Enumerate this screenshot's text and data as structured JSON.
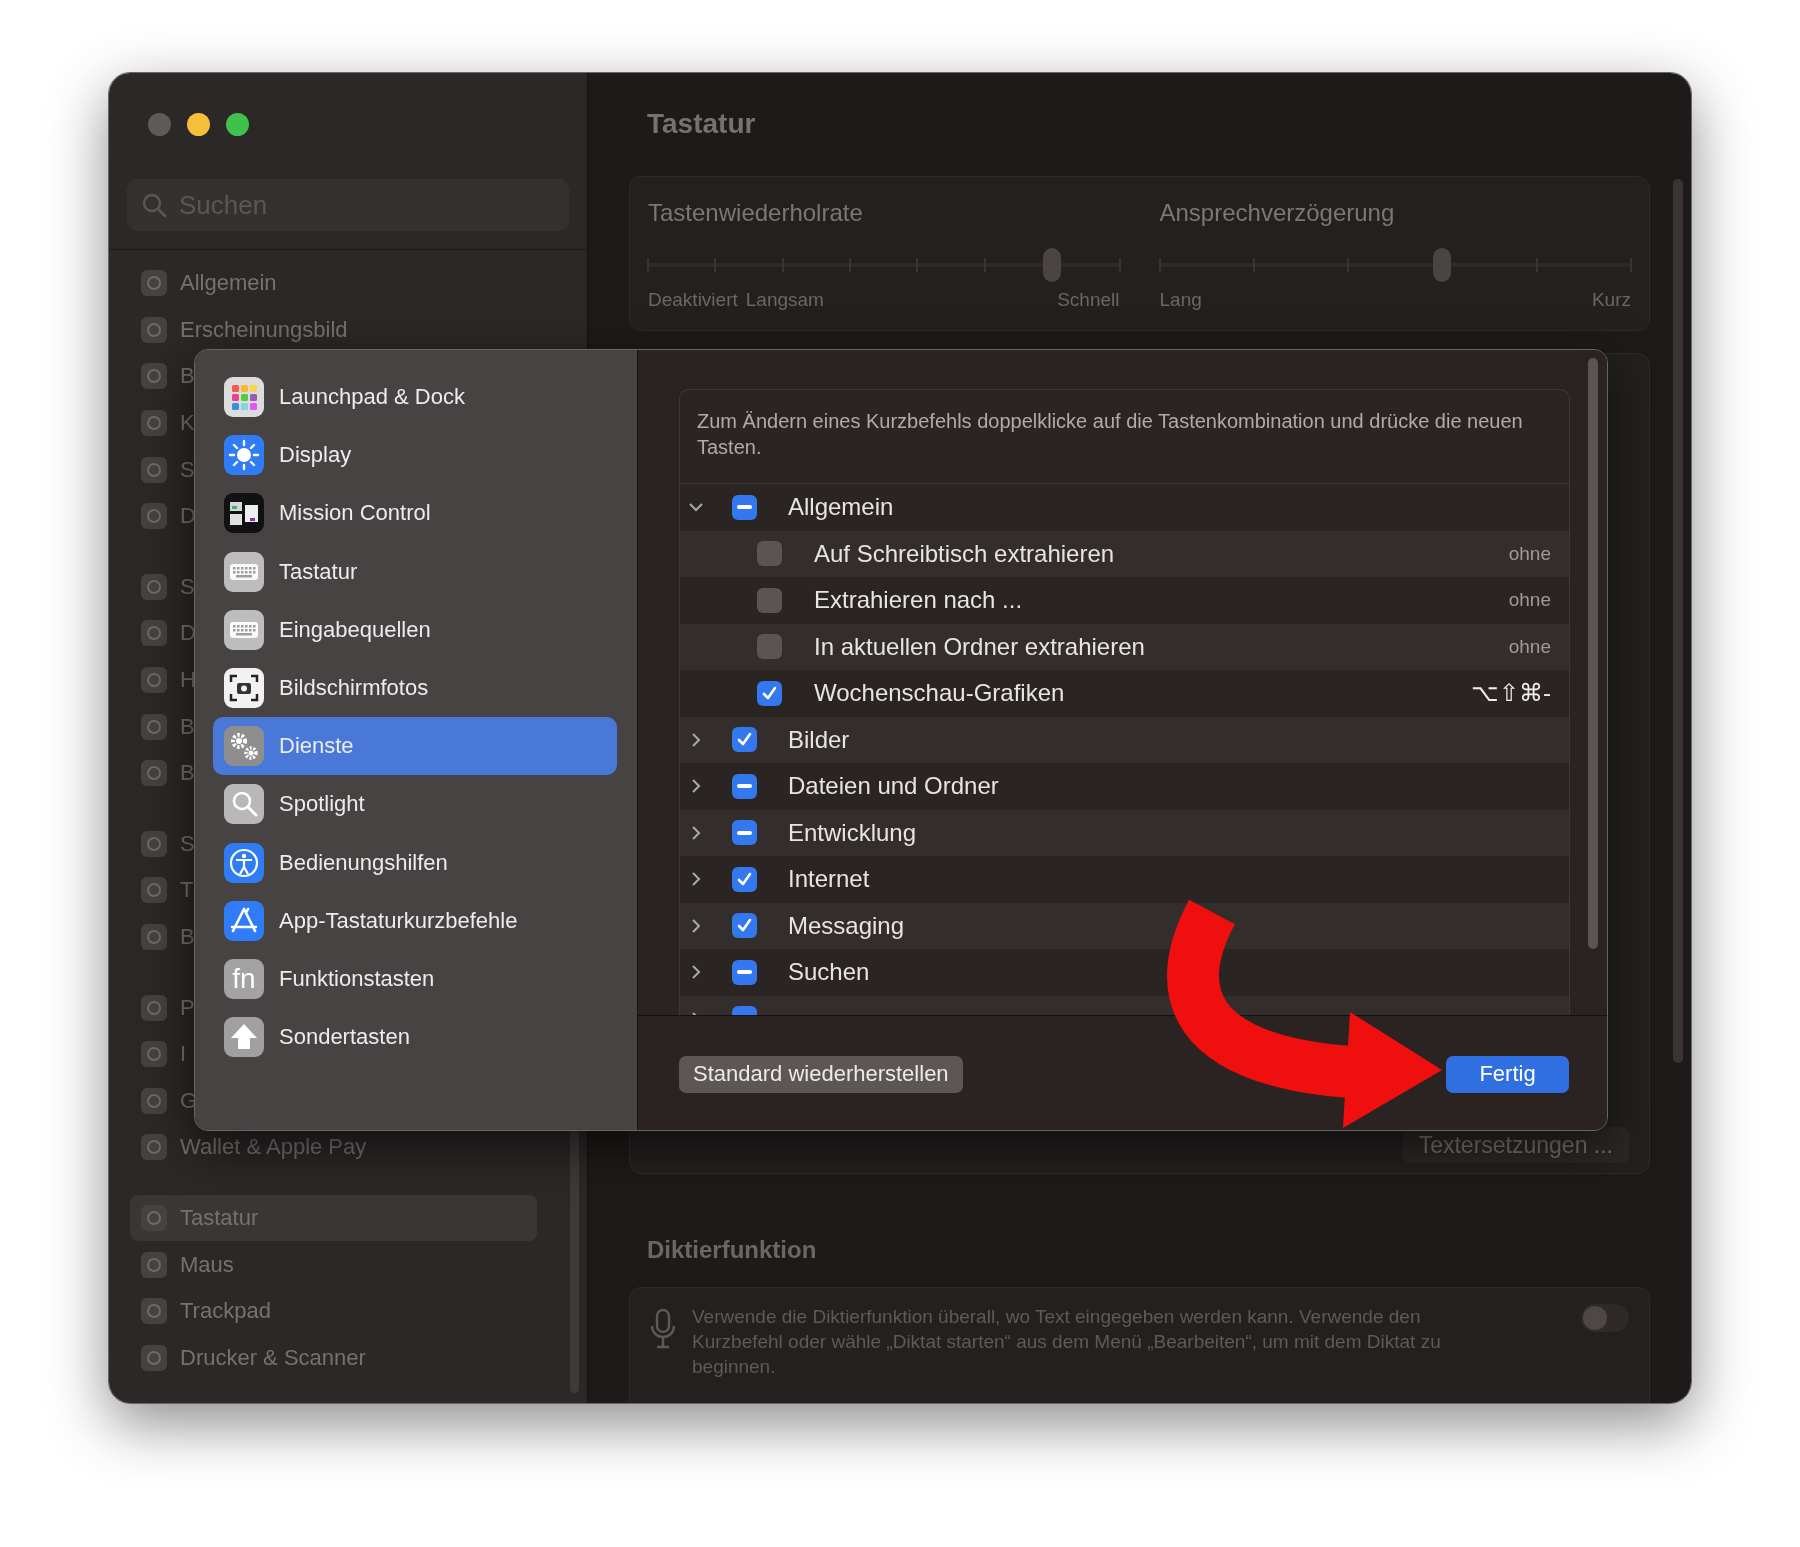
{
  "sidebar": {
    "search": {
      "placeholder": "Suchen"
    },
    "groups": [
      {
        "items": [
          {
            "label": "Allgemein",
            "selected": false
          },
          {
            "label": "Erscheinungsbild",
            "selected": false
          },
          {
            "label": "B",
            "selected": false
          },
          {
            "label": "K",
            "selected": false
          },
          {
            "label": "S",
            "selected": false
          },
          {
            "label": "D",
            "selected": false
          }
        ]
      },
      {
        "items": [
          {
            "label": "S",
            "selected": false
          },
          {
            "label": "D",
            "selected": false
          },
          {
            "label": "H",
            "selected": false
          },
          {
            "label": "B",
            "selected": false
          },
          {
            "label": "B",
            "selected": false
          }
        ]
      },
      {
        "items": [
          {
            "label": "S",
            "selected": false
          },
          {
            "label": "T",
            "selected": false
          },
          {
            "label": "B",
            "selected": false
          }
        ]
      },
      {
        "items": [
          {
            "label": "P",
            "selected": false
          },
          {
            "label": "I",
            "selected": false
          },
          {
            "label": "G",
            "selected": false
          },
          {
            "label": "Wallet & Apple Pay",
            "selected": false
          }
        ]
      },
      {
        "items": [
          {
            "label": "Tastatur",
            "selected": true
          },
          {
            "label": "Maus",
            "selected": false
          },
          {
            "label": "Trackpad",
            "selected": false
          },
          {
            "label": "Drucker & Scanner",
            "selected": false
          }
        ]
      }
    ]
  },
  "page": {
    "title": "Tastatur"
  },
  "key_sliders": [
    {
      "title": "Tastenwiederholrate",
      "level": 0.857,
      "labels": [
        "Deaktiviert",
        "Langsam",
        "Schnell"
      ]
    },
    {
      "title": "Ansprechverzögerung",
      "level": 0.6,
      "labels": [
        "Lang",
        "Kurz"
      ]
    }
  ],
  "text_replacements_button": "Textersetzungen ...",
  "dictation": {
    "heading": "Diktierfunktion",
    "description": "Verwende die Diktierfunktion überall, wo Text eingegeben werden kann. Verwende den Kurzbefehl oder wähle „Diktat starten“ aus dem Menü „Bearbeiten“, um mit dem Diktat zu beginnen.",
    "on": false
  },
  "sheet": {
    "categories": [
      {
        "label": "Launchpad & Dock",
        "selected": false
      },
      {
        "label": "Display",
        "selected": false
      },
      {
        "label": "Mission Control",
        "selected": false
      },
      {
        "label": "Tastatur",
        "selected": false
      },
      {
        "label": "Eingabequellen",
        "selected": false
      },
      {
        "label": "Bildschirmfotos",
        "selected": false
      },
      {
        "label": "Dienste",
        "selected": true
      },
      {
        "label": "Spotlight",
        "selected": false
      },
      {
        "label": "Bedienungshilfen",
        "selected": false
      },
      {
        "label": "App-Tastaturkurzbefehle",
        "selected": false
      },
      {
        "label": "Funktionstasten",
        "selected": false,
        "icon_text": "fn"
      },
      {
        "label": "Sondertasten",
        "selected": false
      }
    ],
    "instructions": "Zum Ändern eines Kurzbefehls doppelklicke auf die Tastenkombination und drücke die neuen Tasten.",
    "services": [
      {
        "label": "Allgemein",
        "checked": true,
        "mixed": true,
        "expanded": true,
        "children": [
          {
            "label": "Auf Schreibtisch extrahieren",
            "checked": false,
            "shortcut": {
              "text": "ohne",
              "kind": "placeholder"
            }
          },
          {
            "label": "Extrahieren nach ...",
            "checked": false,
            "shortcut": {
              "text": "ohne",
              "kind": "placeholder"
            }
          },
          {
            "label": "In aktuellen Ordner extrahieren",
            "checked": false,
            "shortcut": {
              "text": "ohne",
              "kind": "placeholder"
            }
          },
          {
            "label": "Wochenschau-Grafiken",
            "checked": true,
            "shortcut": {
              "text": "⌥⇧⌘-",
              "kind": "keys"
            }
          }
        ]
      },
      {
        "label": "Bilder",
        "checked": true,
        "mixed": false,
        "expanded": false
      },
      {
        "label": "Dateien und Ordner",
        "checked": true,
        "mixed": true,
        "expanded": false
      },
      {
        "label": "Entwicklung",
        "checked": true,
        "mixed": true,
        "expanded": false
      },
      {
        "label": "Internet",
        "checked": true,
        "mixed": false,
        "expanded": false
      },
      {
        "label": "Messaging",
        "checked": true,
        "mixed": false,
        "expanded": false
      },
      {
        "label": "Suchen",
        "checked": true,
        "mixed": true,
        "expanded": false
      },
      {
        "checked": true,
        "expanded": false
      }
    ],
    "buttons": [
      {
        "label": "Standard wiederherstellen",
        "kind": "secondary"
      },
      {
        "label": "Fertig",
        "kind": "primary"
      }
    ]
  }
}
